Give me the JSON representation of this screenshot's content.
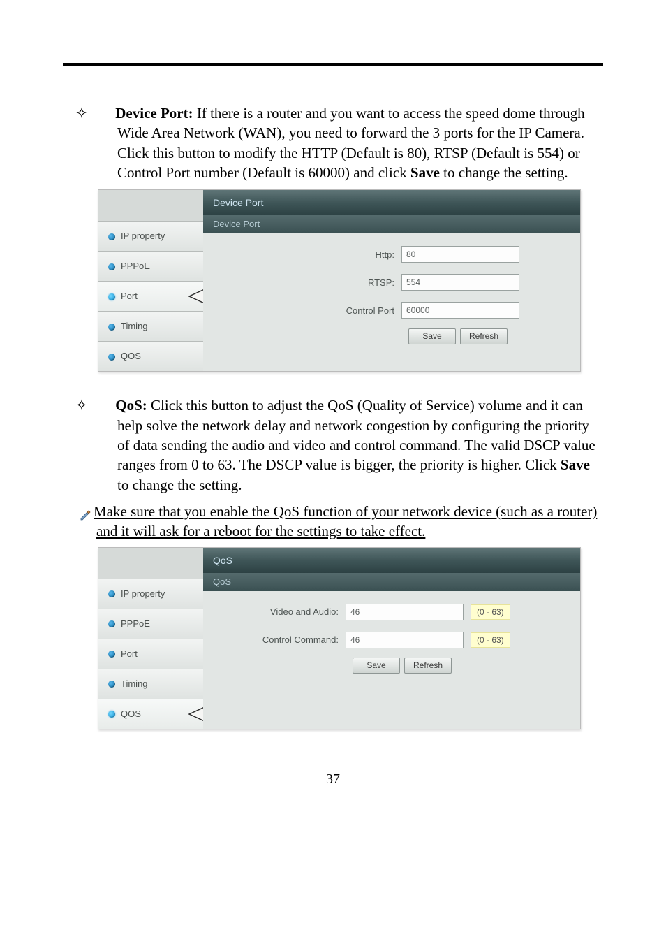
{
  "sections": {
    "devicePort": {
      "title_bold": "Device Port:",
      "text_after_bold": " If there is a router and you want to access the speed dome through Wide Area Network (WAN), you need to forward the 3 ports for the IP Camera.    Click this button to modify the HTTP (Default is 80), RTSP (Default is 554) or Control Port number (Default is 60000) and click ",
      "save_word": "Save",
      "text_tail": " to change the setting."
    },
    "qos": {
      "title_bold": "QoS:",
      "text_after_bold": " Click this button to adjust the QoS (Quality of Service) volume and it can help solve the network delay and network congestion by configuring the priority of data sending the audio and video and control command.    The valid DSCP value ranges from 0 to 63. The DSCP value is bigger, the priority is higher. Click ",
      "save_word": "Save",
      "text_tail": " to change the setting.",
      "note": "Make sure that you enable the QoS function of your network device (such as a router) and it will ask for a reboot for the settings to take effect."
    }
  },
  "screenshot1": {
    "header": "Device Port",
    "subheader": "Device Port",
    "sidebar": [
      "IP property",
      "PPPoE",
      "Port",
      "Timing",
      "QOS"
    ],
    "active_index": 2,
    "fields": [
      {
        "label": "Http:",
        "value": "80"
      },
      {
        "label": "RTSP:",
        "value": "554"
      },
      {
        "label": "Control Port",
        "value": "60000"
      }
    ],
    "buttons": {
      "save": "Save",
      "refresh": "Refresh"
    }
  },
  "screenshot2": {
    "header": "QoS",
    "subheader": "QoS",
    "sidebar": [
      "IP property",
      "PPPoE",
      "Port",
      "Timing",
      "QOS"
    ],
    "active_index": 4,
    "fields": [
      {
        "label": "Video and Audio:",
        "value": "46",
        "hint": "(0 - 63)"
      },
      {
        "label": "Control Command:",
        "value": "46",
        "hint": "(0 - 63)"
      }
    ],
    "buttons": {
      "save": "Save",
      "refresh": "Refresh"
    }
  },
  "page_number": "37"
}
